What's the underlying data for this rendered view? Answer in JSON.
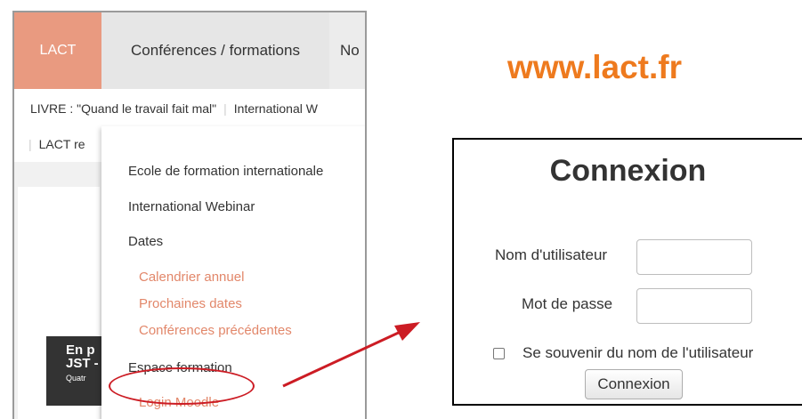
{
  "site": {
    "nav": {
      "active": "LACT",
      "item2": "Conférences / formations",
      "item3_partial": "No"
    },
    "subnav": {
      "item1": "LIVRE : \"Quand le travail fait mal\"",
      "item2_partial": "International W",
      "item3_partial": "LACT re"
    },
    "banner": {
      "line1": "En p",
      "line2": "JST -",
      "line3": "Quatr"
    },
    "dropdown": {
      "items": [
        "Ecole de formation internationale",
        "International Webinar",
        "Dates"
      ],
      "sub_items": [
        "Calendrier annuel",
        "Prochaines dates",
        "Conférences précédentes"
      ],
      "espace": "Espace formation",
      "login": "Login Moodle"
    }
  },
  "url": "www.lact.fr",
  "login_panel": {
    "title": "Connexion",
    "username_label": "Nom d'utilisateur",
    "username_value": "",
    "password_label": "Mot de passe",
    "password_value": "",
    "remember_label": "Se souvenir du nom de l'utilisateur",
    "remember_checked": false,
    "button_label": "Connexion"
  },
  "colors": {
    "accent_orange": "#ee7a1e",
    "nav_active": "#e99a80",
    "submenu_text": "#e2876a",
    "annotation_red": "#cc1c24"
  }
}
